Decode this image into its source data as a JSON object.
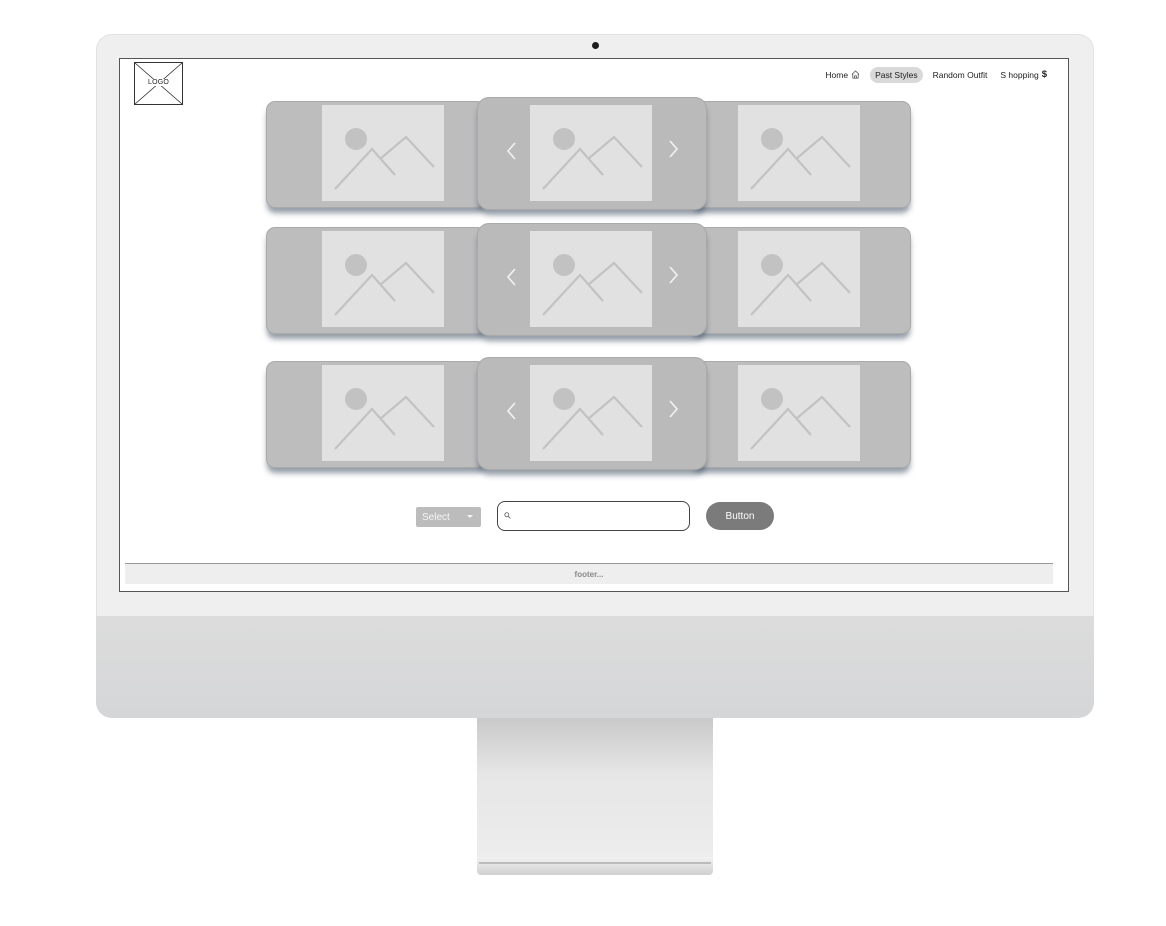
{
  "logo": {
    "text": "LOGO"
  },
  "nav": {
    "items": [
      {
        "label": "Home",
        "icon": "home-icon"
      },
      {
        "label": "Past Styles",
        "active": true
      },
      {
        "label": "Random Outfit"
      },
      {
        "label": "S hopping",
        "suffix": "$"
      }
    ]
  },
  "carousels": [
    {
      "row": 1,
      "slides": [
        "image-placeholder",
        "image-placeholder",
        "image-placeholder"
      ]
    },
    {
      "row": 2,
      "slides": [
        "image-placeholder",
        "image-placeholder",
        "image-placeholder"
      ]
    },
    {
      "row": 3,
      "slides": [
        "image-placeholder",
        "image-placeholder",
        "image-placeholder"
      ]
    }
  ],
  "controls": {
    "select_label": "Select",
    "search_placeholder": "",
    "button_label": "Button"
  },
  "footer": {
    "text": "footer..."
  },
  "colors": {
    "card": "#bdbdbd",
    "image_placeholder": "#e1e1e1",
    "active_nav": "#d9d9d9",
    "button": "#7b7b7b"
  }
}
